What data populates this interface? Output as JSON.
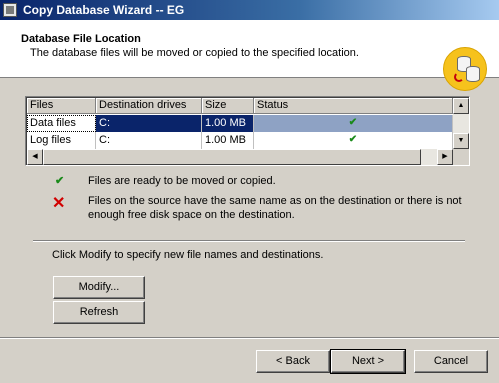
{
  "window": {
    "title": "Copy Database Wizard  -- EG"
  },
  "header": {
    "title": "Database File Location",
    "subtitle": "The database files will be moved or copied to the specified location."
  },
  "table": {
    "columns": [
      "Files",
      "Destination drives",
      "Size",
      "Status"
    ],
    "rows": [
      {
        "files": "Data files",
        "drive": "C:",
        "size": "1.00 MB",
        "status": "ready"
      },
      {
        "files": "Log files",
        "drive": "C:",
        "size": "1.00 MB",
        "status": "ready"
      }
    ]
  },
  "legend": {
    "ok_text": "Files are ready to be moved or copied.",
    "bad_text": "Files on the source have the same name as on the destination or there is not enough free disk space on the destination."
  },
  "hint": "Click Modify to specify new file names and destinations.",
  "buttons": {
    "modify": "Modify...",
    "refresh": "Refresh",
    "back": "< Back",
    "next": "Next >",
    "cancel": "Cancel"
  },
  "icons": {
    "check": "✔",
    "cross": "✕"
  },
  "colors": {
    "title_bar": "#0a246a",
    "selection": "#0a246a",
    "ok": "#1a8a1a",
    "error": "#d10000",
    "wizard_icon_bg": "#f6c21c"
  }
}
